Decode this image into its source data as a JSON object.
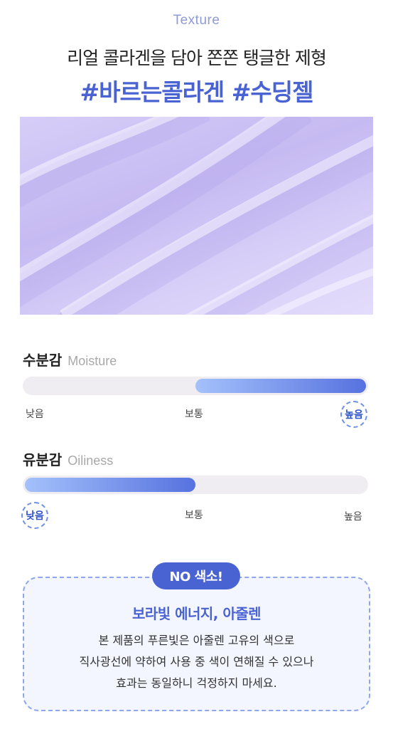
{
  "header": {
    "eyebrow": "Texture",
    "headline": "리얼 콜라겐을 담아 쫀쫀 탱글한 제형",
    "hashtags": "#바르는콜라겐 #수딩젤"
  },
  "texture_image": {
    "description_icon": "gel-texture-swatch",
    "color": "#cbbff4"
  },
  "moisture": {
    "label": "수분감",
    "label_en": "Moisture",
    "level": "높음",
    "fill_range": [
      0.5,
      1.0
    ],
    "scale": [
      "낮음",
      "보통",
      "높음"
    ]
  },
  "oiliness": {
    "label": "유분감",
    "label_en": "Oiliness",
    "level": "낮음",
    "fill_range": [
      0.0,
      0.5
    ],
    "scale": [
      "낮음",
      "보통",
      "높음"
    ]
  },
  "notice": {
    "badge": "NO 색소!",
    "title": "보라빛 에너지, 아줄렌",
    "lines": [
      "본 제품의 푸른빛은 아줄렌 고유의 색으로",
      "직사광선에 약하여 사용 중 색이 연해질 수 있으나",
      "효과는 동일하니 걱정하지 마세요."
    ]
  },
  "colors": {
    "accent": "#4a63d3",
    "eyebrow": "#8f9ad6",
    "track": "#efedf1"
  }
}
